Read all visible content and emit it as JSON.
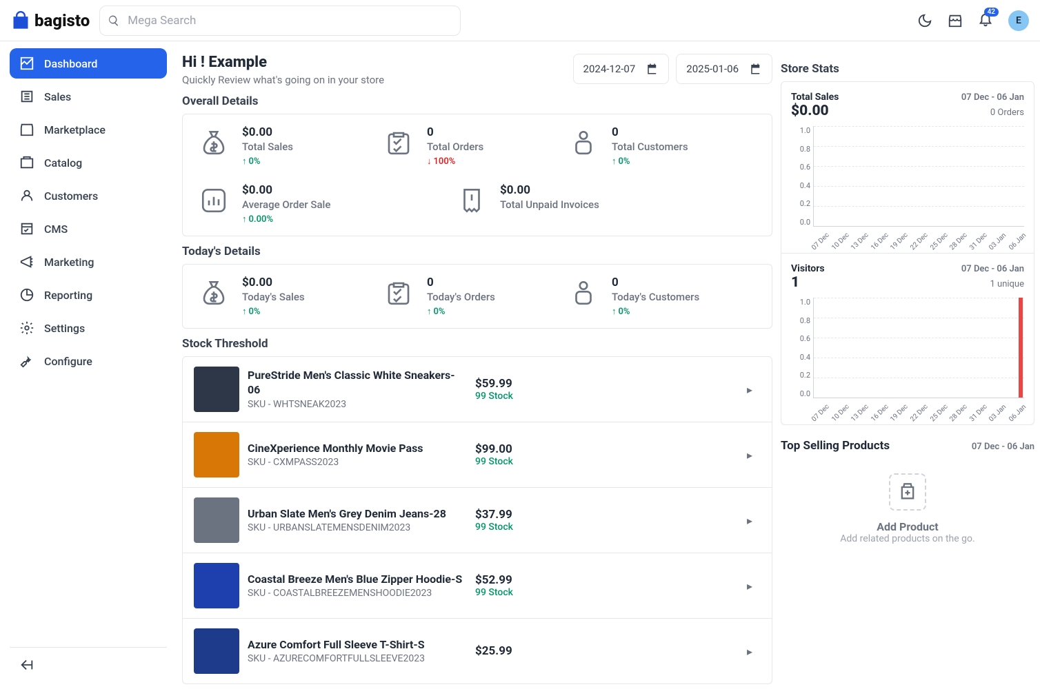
{
  "brand": "bagisto",
  "search": {
    "placeholder": "Mega Search"
  },
  "topbar": {
    "badge": "42",
    "avatar": "E"
  },
  "sidebar": {
    "items": [
      {
        "label": "Dashboard"
      },
      {
        "label": "Sales"
      },
      {
        "label": "Marketplace"
      },
      {
        "label": "Catalog"
      },
      {
        "label": "Customers"
      },
      {
        "label": "CMS"
      },
      {
        "label": "Marketing"
      },
      {
        "label": "Reporting"
      },
      {
        "label": "Settings"
      },
      {
        "label": "Configure"
      }
    ]
  },
  "page": {
    "greeting": "Hi ! Example",
    "subtitle": "Quickly Review what's going on in your store",
    "date_from": "2024-12-07",
    "date_to": "2025-01-06"
  },
  "sections": {
    "overall": "Overall Details",
    "today": "Today's Details",
    "stock": "Stock Threshold",
    "store_stats": "Store Stats",
    "top_selling": "Top Selling Products"
  },
  "overall": {
    "total_sales": {
      "value": "$0.00",
      "label": "Total Sales",
      "delta": "0%",
      "dir": "up"
    },
    "total_orders": {
      "value": "0",
      "label": "Total Orders",
      "delta": "100%",
      "dir": "down"
    },
    "total_customers": {
      "value": "0",
      "label": "Total Customers",
      "delta": "0%",
      "dir": "up"
    },
    "avg_order": {
      "value": "$0.00",
      "label": "Average Order Sale",
      "delta": "0.00%",
      "dir": "up"
    },
    "unpaid": {
      "value": "$0.00",
      "label": "Total Unpaid Invoices"
    }
  },
  "today": {
    "sales": {
      "value": "$0.00",
      "label": "Today's Sales",
      "delta": "0%",
      "dir": "up"
    },
    "orders": {
      "value": "0",
      "label": "Today's Orders",
      "delta": "0%",
      "dir": "up"
    },
    "customers": {
      "value": "0",
      "label": "Today's Customers",
      "delta": "0%",
      "dir": "up"
    }
  },
  "stock": [
    {
      "name": "PureStride Men's Classic White Sneakers-06",
      "sku": "SKU - WHTSNEAK2023",
      "price": "$59.99",
      "qty": "99 Stock"
    },
    {
      "name": "CineXperience Monthly Movie Pass",
      "sku": "SKU - CXMPASS2023",
      "price": "$99.00",
      "qty": "99 Stock"
    },
    {
      "name": "Urban Slate Men's Grey Denim Jeans-28",
      "sku": "SKU - URBANSLATEMENSDENIM2023",
      "price": "$37.99",
      "qty": "99 Stock"
    },
    {
      "name": "Coastal Breeze Men's Blue Zipper Hoodie-S",
      "sku": "SKU - COASTALBREEZEMENSHOODIE2023",
      "price": "$52.99",
      "qty": "99 Stock"
    },
    {
      "name": "Azure Comfort Full Sleeve T-Shirt-S",
      "sku": "SKU - AZURECOMFORTFULLSLEEVE2023",
      "price": "$25.99",
      "qty": ""
    }
  ],
  "store_stats": {
    "range": "07 Dec - 06 Jan",
    "sales": {
      "title": "Total Sales",
      "value": "$0.00",
      "sub": "0 Orders"
    },
    "visitors": {
      "title": "Visitors",
      "value": "1",
      "sub": "1 unique"
    }
  },
  "chart_data": [
    {
      "type": "bar",
      "title": "Total Sales",
      "xlabel": "",
      "ylabel": "",
      "categories": [
        "07 Dec",
        "10 Dec",
        "13 Dec",
        "16 Dec",
        "19 Dec",
        "22 Dec",
        "25 Dec",
        "28 Dec",
        "31 Dec",
        "03 Jan",
        "06 Jan"
      ],
      "values": [
        0,
        0,
        0,
        0,
        0,
        0,
        0,
        0,
        0,
        0,
        0
      ],
      "ylim": [
        0,
        1.0
      ],
      "yticks": [
        0,
        0.2,
        0.4,
        0.6,
        0.8,
        1.0
      ]
    },
    {
      "type": "bar",
      "title": "Visitors",
      "xlabel": "",
      "ylabel": "",
      "categories": [
        "07 Dec",
        "10 Dec",
        "13 Dec",
        "16 Dec",
        "19 Dec",
        "22 Dec",
        "25 Dec",
        "28 Dec",
        "31 Dec",
        "03 Jan",
        "06 Jan"
      ],
      "values": [
        0,
        0,
        0,
        0,
        0,
        0,
        0,
        0,
        0,
        0,
        1
      ],
      "ylim": [
        0,
        1.0
      ],
      "yticks": [
        0,
        0.2,
        0.4,
        0.6,
        0.8,
        1.0
      ]
    }
  ],
  "empty": {
    "title": "Add Product",
    "sub": "Add related products on the go."
  }
}
